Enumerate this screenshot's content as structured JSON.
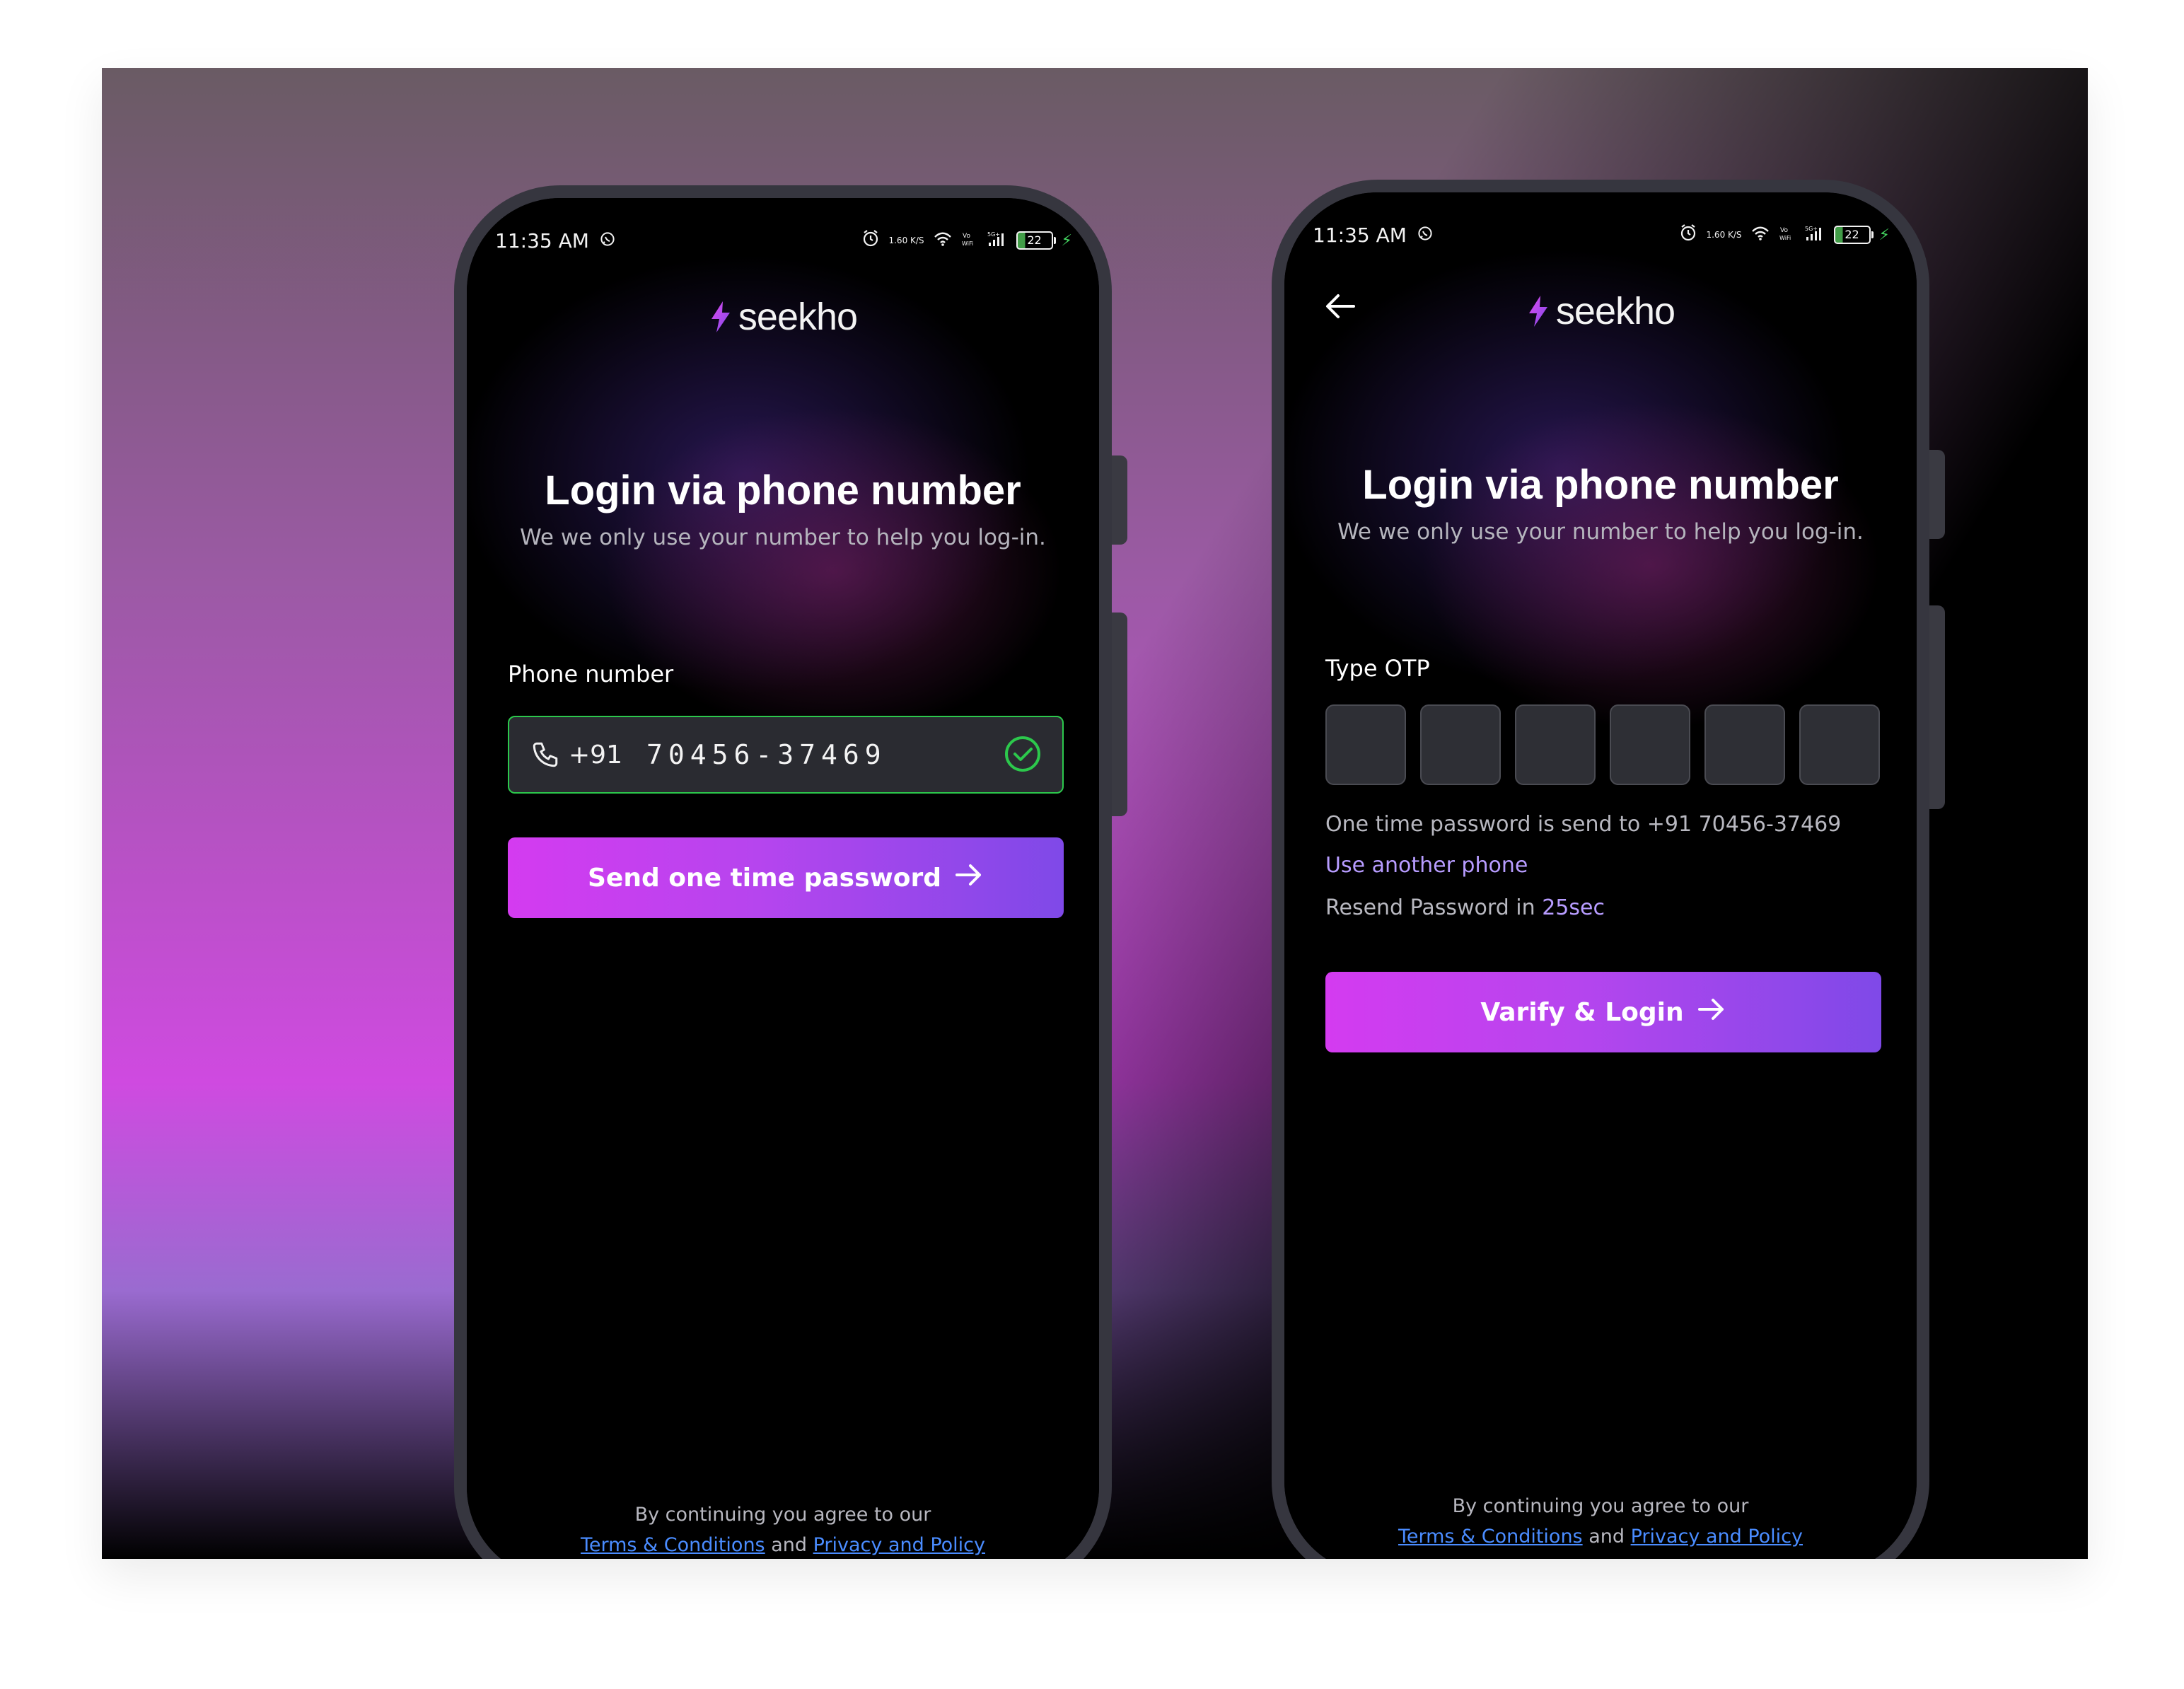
{
  "phones": {
    "left": {
      "status": {
        "time": "11:35 AM",
        "network": "1.60\nK/S",
        "battery": "22"
      },
      "brand": "seekho",
      "title": "Login via phone number",
      "subtitle": "We we only use your number to help you log-in.",
      "phone_label": "Phone number",
      "country_code": "+91",
      "phone_number": "70456-37469",
      "button_label": "Send one time password",
      "footer": {
        "prefix": "By continuing you agree to our",
        "terms": "Terms & Conditions",
        "and": "and",
        "privacy": "Privacy and Policy"
      }
    },
    "right": {
      "status": {
        "time": "11:35 AM",
        "network": "1.60\nK/S",
        "battery": "22"
      },
      "brand": "seekho",
      "title": "Login via phone number",
      "subtitle": "We we only use your number to help you log-in.",
      "otp_label": "Type OTP",
      "otp_sent": "One time password is send to +91 70456-37469",
      "use_another_phone": "Use another phone",
      "resend_prefix": "Resend Password in",
      "resend_time": "25sec",
      "button_label": "Varify & Login",
      "footer": {
        "prefix": "By continuing you agree to our",
        "terms": "Terms & Conditions",
        "and": "and",
        "privacy": "Privacy and Policy"
      }
    }
  },
  "colors": {
    "brand_gradient_start": "#d43bf0",
    "brand_gradient_end": "#7f49e8",
    "success": "#2cc84c",
    "link": "#4a8cff",
    "accent_text": "#b79cff"
  },
  "icons": [
    "whatsapp-icon",
    "alarm-icon",
    "wifi-icon",
    "volte-icon",
    "signal-icon",
    "battery-icon",
    "charging-icon",
    "brand-bolt-icon",
    "phone-icon",
    "check-circle-icon",
    "arrow-right-icon",
    "arrow-left-icon"
  ]
}
